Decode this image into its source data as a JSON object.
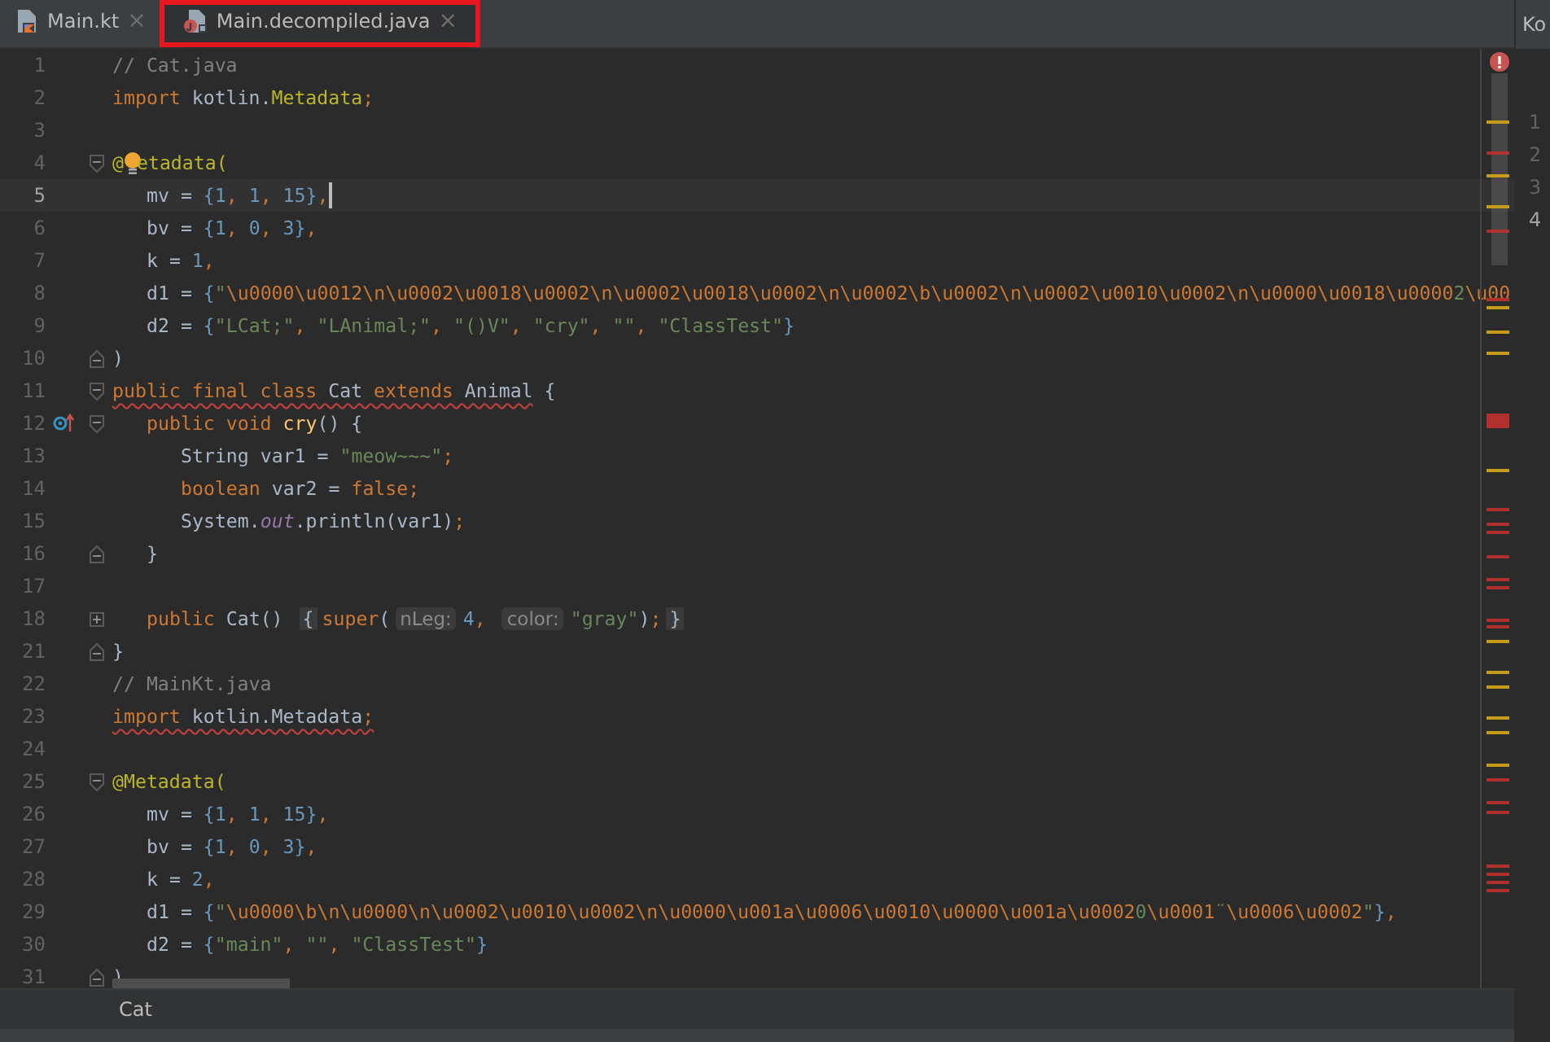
{
  "tabs": [
    {
      "label": "Main.kt",
      "kind": "kotlin",
      "selected": false,
      "highlighted": false
    },
    {
      "label": "Main.decompiled.java",
      "kind": "java",
      "selected": true,
      "highlighted": true
    }
  ],
  "close_glyph": "×",
  "editor": {
    "lines": [
      {
        "num": "1",
        "current": false,
        "tokens": [
          {
            "text": "// Cat.java",
            "kind": "cmt"
          }
        ]
      },
      {
        "num": "2",
        "current": false,
        "tokens": [
          {
            "text": "import",
            "kind": "kw"
          },
          {
            "text": " kotlin.",
            "kind": "plain"
          },
          {
            "text": "Metadata",
            "kind": "ann"
          },
          {
            "text": ";",
            "kind": "kw"
          }
        ]
      },
      {
        "num": "3",
        "current": false
      },
      {
        "num": "4",
        "current": false,
        "fold": {
          "kind": "open"
        },
        "bulb": true,
        "tokens": [
          {
            "text": "@",
            "kind": "ann"
          },
          {
            "text": "etadata(",
            "kind": "ann"
          }
        ],
        "children": [
          {
            "num": "5",
            "current": true,
            "tokens": [
              {
                "text": "mv = ",
                "kind": "plain"
              },
              {
                "text": "{1",
                "kind": "num"
              },
              {
                "text": ", ",
                "kind": "kw"
              },
              {
                "text": "1",
                "kind": "num"
              },
              {
                "text": ", ",
                "kind": "kw"
              },
              {
                "text": "15}",
                "kind": "num"
              },
              {
                "text": ",",
                "kind": "kw"
              }
            ]
          },
          {
            "num": "6",
            "current": false,
            "tokens": [
              {
                "text": "bv = ",
                "kind": "plain"
              },
              {
                "text": "{1",
                "kind": "num"
              },
              {
                "text": ", ",
                "kind": "kw"
              },
              {
                "text": "0",
                "kind": "num"
              },
              {
                "text": ", ",
                "kind": "kw"
              },
              {
                "text": "3}",
                "kind": "num"
              },
              {
                "text": ",",
                "kind": "kw"
              }
            ]
          },
          {
            "num": "7",
            "current": false,
            "tokens": [
              {
                "text": "k = ",
                "kind": "plain"
              },
              {
                "text": "1",
                "kind": "num"
              },
              {
                "text": ",",
                "kind": "kw"
              }
            ]
          },
          {
            "num": "8",
            "current": false,
            "tokens": [
              {
                "text": "d1 = ",
                "kind": "plain"
              },
              {
                "text": "{",
                "kind": "num"
              },
              {
                "text": "\"",
                "kind": "str"
              },
              {
                "text": "\\u0000\\u0012\\n\\u0002\\u0018\\u0002\\n\\u0002\\u0018\\u0002\\n\\u0002\\b\\u0002\\n\\u0002\\u0010\\u0002\\n\\u0000\\u0018\\u0000",
                "kind": "esc"
              },
              {
                "text": "2",
                "kind": "str"
              },
              {
                "text": "\\u00",
                "kind": "esc"
              }
            ]
          },
          {
            "num": "9",
            "current": false,
            "tokens": [
              {
                "text": "d2 = ",
                "kind": "plain"
              },
              {
                "text": "{",
                "kind": "num"
              },
              {
                "text": "\"LCat;\"",
                "kind": "str"
              },
              {
                "text": ", ",
                "kind": "kw"
              },
              {
                "text": "\"LAnimal;\"",
                "kind": "str"
              },
              {
                "text": ", ",
                "kind": "kw"
              },
              {
                "text": "\"()V\"",
                "kind": "str"
              },
              {
                "text": ", ",
                "kind": "kw"
              },
              {
                "text": "\"cry\"",
                "kind": "str"
              },
              {
                "text": ", ",
                "kind": "kw"
              },
              {
                "text": "\"\"",
                "kind": "str"
              },
              {
                "text": ", ",
                "kind": "kw"
              },
              {
                "text": "\"ClassTest\"",
                "kind": "str"
              },
              {
                "text": "}",
                "kind": "num"
              }
            ]
          }
        ]
      },
      {
        "num": "10",
        "current": false,
        "fold": {
          "kind": "close"
        },
        "tokens": [
          {
            "text": ")",
            "kind": "plain"
          }
        ]
      },
      {
        "num": "11",
        "current": false,
        "fold": {
          "kind": "open"
        },
        "tokens": [
          {
            "text": "public final class",
            "kind": "kw",
            "squiggle": true
          },
          {
            "text": " Cat ",
            "kind": "plain",
            "squiggle": true
          },
          {
            "text": "extends",
            "kind": "kw",
            "squiggle": true
          },
          {
            "text": " Animal",
            "kind": "plain",
            "squiggle": true
          },
          {
            "text": " {",
            "kind": "plain"
          }
        ],
        "children": [
          {
            "num": "12",
            "current": false,
            "fold": {
              "kind": "open"
            },
            "gutter_icon": {
              "kind": "override"
            },
            "tokens": [
              {
                "text": "public void ",
                "kind": "kw"
              },
              {
                "text": "cry",
                "kind": "fn"
              },
              {
                "text": "() {",
                "kind": "plain"
              }
            ],
            "children": [
              {
                "num": "13",
                "current": false,
                "tokens": [
                  {
                    "text": "String var1 = ",
                    "kind": "plain"
                  },
                  {
                    "text": "\"meow~~~\"",
                    "kind": "str"
                  },
                  {
                    "text": ";",
                    "kind": "kw"
                  }
                ]
              },
              {
                "num": "14",
                "current": false,
                "tokens": [
                  {
                    "text": "boolean ",
                    "kind": "kw"
                  },
                  {
                    "text": "var2 = ",
                    "kind": "plain"
                  },
                  {
                    "text": "false;",
                    "kind": "kw"
                  }
                ]
              },
              {
                "num": "15",
                "current": false,
                "tokens": [
                  {
                    "text": "System.",
                    "kind": "plain"
                  },
                  {
                    "text": "out",
                    "kind": "field"
                  },
                  {
                    "text": ".println(var1)",
                    "kind": "plain"
                  },
                  {
                    "text": ";",
                    "kind": "kw"
                  }
                ]
              }
            ]
          },
          {
            "num": "16",
            "current": false,
            "fold": {
              "kind": "close"
            },
            "tokens": [
              {
                "text": "}",
                "kind": "plain"
              }
            ]
          },
          {
            "num": "17",
            "current": false
          },
          {
            "num": "18",
            "current": false,
            "fold": {
              "kind": "collapsed"
            },
            "tokens": [
              {
                "text": "public ",
                "kind": "kw"
              },
              {
                "text": "Cat() ",
                "kind": "plain"
              },
              {
                "text": "{",
                "kind": "fold"
              },
              {
                "text": "super",
                "kind": "kw"
              },
              {
                "text": "(",
                "kind": "plain"
              },
              {
                "text": "nLeg:",
                "kind": "hint"
              },
              {
                "text": "4",
                "kind": "num"
              },
              {
                "text": ", ",
                "kind": "kw"
              },
              {
                "text": "color:",
                "kind": "hint"
              },
              {
                "text": "\"gray\"",
                "kind": "str"
              },
              {
                "text": ")",
                "kind": "plain"
              },
              {
                "text": ";",
                "kind": "kw"
              },
              {
                "text": "}",
                "kind": "fold"
              }
            ]
          }
        ]
      },
      {
        "num": "21",
        "current": false,
        "fold": {
          "kind": "close"
        },
        "tokens": [
          {
            "text": "}",
            "kind": "plain"
          }
        ]
      },
      {
        "num": "22",
        "current": false,
        "tokens": [
          {
            "text": "// MainKt.java",
            "kind": "cmt"
          }
        ]
      },
      {
        "num": "23",
        "current": false,
        "tokens": [
          {
            "text": "import",
            "kind": "kw",
            "squiggle": true
          },
          {
            "text": " kotlin.Metadata",
            "kind": "plain",
            "squiggle": true
          },
          {
            "text": ";",
            "kind": "kw",
            "squiggle": true
          }
        ]
      },
      {
        "num": "24",
        "current": false
      },
      {
        "num": "25",
        "current": false,
        "fold": {
          "kind": "open"
        },
        "tokens": [
          {
            "text": "@Metadata(",
            "kind": "ann"
          }
        ],
        "children": [
          {
            "num": "26",
            "current": false,
            "tokens": [
              {
                "text": "mv = ",
                "kind": "plain"
              },
              {
                "text": "{1",
                "kind": "num"
              },
              {
                "text": ", ",
                "kind": "kw"
              },
              {
                "text": "1",
                "kind": "num"
              },
              {
                "text": ", ",
                "kind": "kw"
              },
              {
                "text": "15}",
                "kind": "num"
              },
              {
                "text": ",",
                "kind": "kw"
              }
            ]
          },
          {
            "num": "27",
            "current": false,
            "tokens": [
              {
                "text": "bv = ",
                "kind": "plain"
              },
              {
                "text": "{1",
                "kind": "num"
              },
              {
                "text": ", ",
                "kind": "kw"
              },
              {
                "text": "0",
                "kind": "num"
              },
              {
                "text": ", ",
                "kind": "kw"
              },
              {
                "text": "3}",
                "kind": "num"
              },
              {
                "text": ",",
                "kind": "kw"
              }
            ]
          },
          {
            "num": "28",
            "current": false,
            "tokens": [
              {
                "text": "k = ",
                "kind": "plain"
              },
              {
                "text": "2",
                "kind": "num"
              },
              {
                "text": ",",
                "kind": "kw"
              }
            ]
          },
          {
            "num": "29",
            "current": false,
            "tokens": [
              {
                "text": "d1 = ",
                "kind": "plain"
              },
              {
                "text": "{",
                "kind": "num"
              },
              {
                "text": "\"",
                "kind": "str"
              },
              {
                "text": "\\u0000\\b\\n\\u0000\\n\\u0002\\u0010\\u0002\\n\\u0000\\u001a\\u0006\\u0010\\u0000\\u001a\\u0002",
                "kind": "esc"
              },
              {
                "text": "0",
                "kind": "str"
              },
              {
                "text": "\\u0001",
                "kind": "esc"
              },
              {
                "text": "¨",
                "kind": "str"
              },
              {
                "text": "\\u0006\\u0002",
                "kind": "esc"
              },
              {
                "text": "\"",
                "kind": "str"
              },
              {
                "text": "}",
                "kind": "num"
              },
              {
                "text": ",",
                "kind": "kw"
              }
            ]
          },
          {
            "num": "30",
            "current": false,
            "tokens": [
              {
                "text": "d2 = ",
                "kind": "plain"
              },
              {
                "text": "{",
                "kind": "num"
              },
              {
                "text": "\"main\"",
                "kind": "str"
              },
              {
                "text": ", ",
                "kind": "kw"
              },
              {
                "text": "\"\"",
                "kind": "str"
              },
              {
                "text": ", ",
                "kind": "kw"
              },
              {
                "text": "\"ClassTest\"",
                "kind": "str"
              },
              {
                "text": "}",
                "kind": "num"
              }
            ]
          }
        ]
      },
      {
        "num": "31",
        "current": false,
        "fold": {
          "kind": "close"
        },
        "tokens": [
          {
            "text": ")",
            "kind": "plain"
          }
        ]
      }
    ]
  },
  "side_panel": {
    "tab": "Ko",
    "items": [
      {
        "label": "1",
        "selected": false
      },
      {
        "label": "2",
        "selected": false
      },
      {
        "label": "3",
        "selected": false
      },
      {
        "label": "4",
        "selected": true
      }
    ]
  },
  "breadcrumb": "Cat"
}
